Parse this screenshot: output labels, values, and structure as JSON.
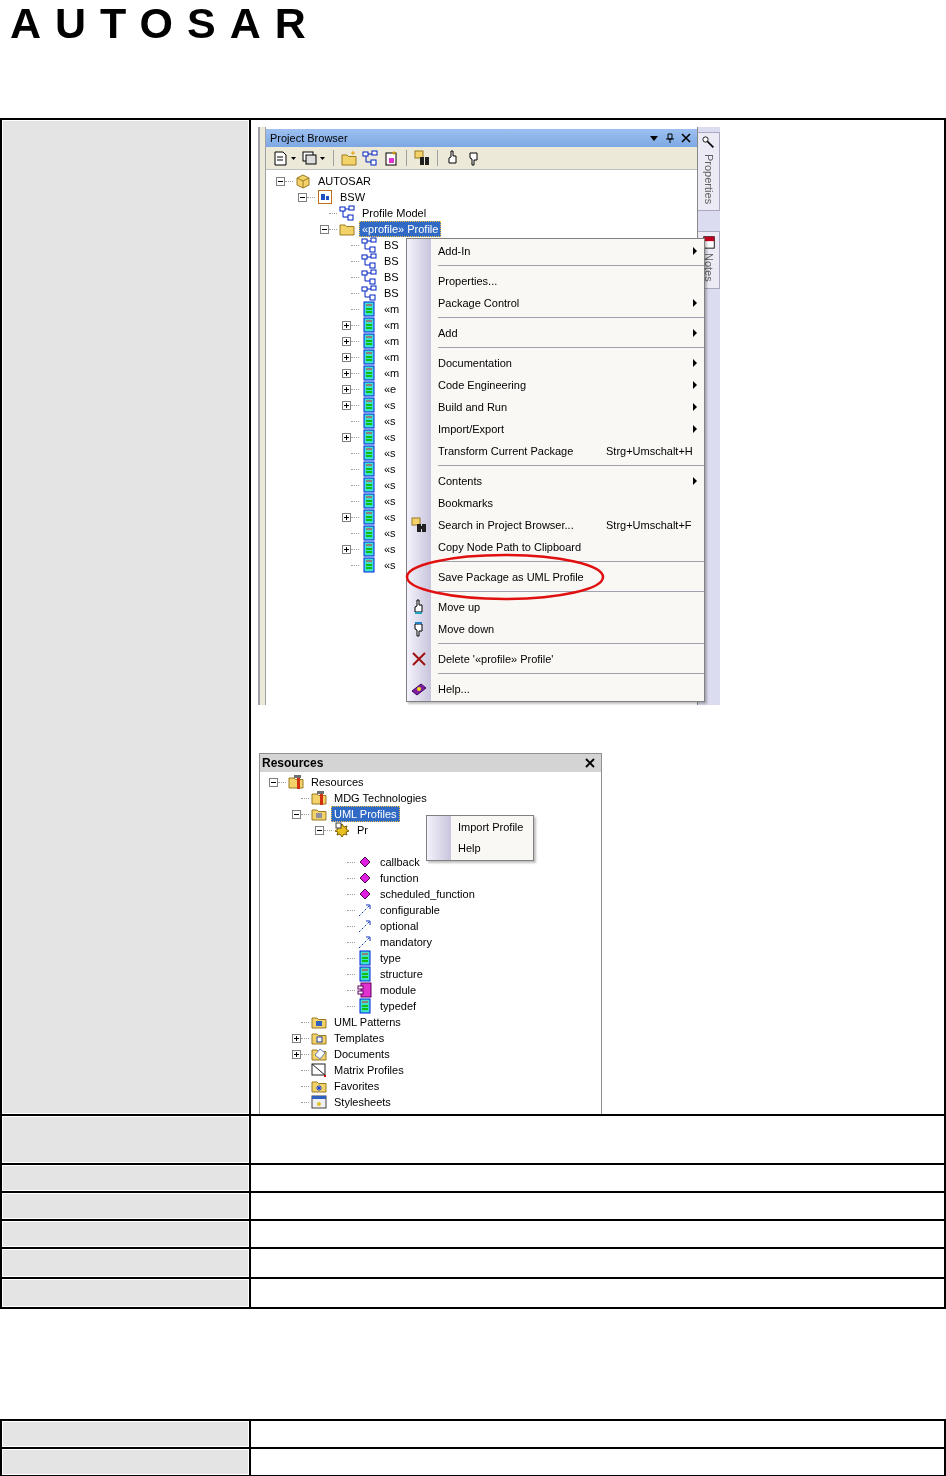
{
  "logo": "AUTOSAR",
  "project_browser": {
    "title": "Project Browser",
    "side_tabs": [
      "Properties",
      "Notes"
    ],
    "tree": [
      {
        "label": "AUTOSAR",
        "kind": "root-package",
        "expanded": true,
        "selected": false,
        "children": [
          {
            "label": "BSW",
            "kind": "model-package",
            "expanded": true,
            "selected": false,
            "children": [
              {
                "label": "Profile Model",
                "kind": "diagram",
                "selected": false
              },
              {
                "label": "«profile» Profile",
                "kind": "folder",
                "expanded": true,
                "selected": true,
                "children": [
                  {
                    "label": "BS",
                    "kind": "diagram",
                    "selected": false
                  },
                  {
                    "label": "BS",
                    "kind": "diagram",
                    "selected": false
                  },
                  {
                    "label": "BS",
                    "kind": "diagram",
                    "selected": false
                  },
                  {
                    "label": "BS",
                    "kind": "diagram",
                    "selected": false
                  },
                  {
                    "label": "«m",
                    "kind": "class",
                    "selected": false
                  },
                  {
                    "label": "«m",
                    "kind": "class",
                    "expanded": false,
                    "selected": false
                  },
                  {
                    "label": "«m",
                    "kind": "class",
                    "expanded": false,
                    "selected": false
                  },
                  {
                    "label": "«m",
                    "kind": "class",
                    "expanded": false,
                    "selected": false
                  },
                  {
                    "label": "«m",
                    "kind": "class",
                    "expanded": false,
                    "selected": false
                  },
                  {
                    "label": "«e",
                    "kind": "class",
                    "expanded": false,
                    "selected": false
                  },
                  {
                    "label": "«s",
                    "kind": "class",
                    "expanded": false,
                    "selected": false
                  },
                  {
                    "label": "«s",
                    "kind": "class",
                    "selected": false
                  },
                  {
                    "label": "«s",
                    "kind": "class",
                    "expanded": false,
                    "selected": false
                  },
                  {
                    "label": "«s",
                    "kind": "class",
                    "selected": false
                  },
                  {
                    "label": "«s",
                    "kind": "class",
                    "selected": false
                  },
                  {
                    "label": "«s",
                    "kind": "class",
                    "selected": false
                  },
                  {
                    "label": "«s",
                    "kind": "class",
                    "selected": false
                  },
                  {
                    "label": "«s",
                    "kind": "class",
                    "expanded": false,
                    "selected": false
                  },
                  {
                    "label": "«s",
                    "kind": "class",
                    "selected": false
                  },
                  {
                    "label": "«s",
                    "kind": "class",
                    "expanded": false,
                    "selected": false
                  },
                  {
                    "label": "«s",
                    "kind": "class",
                    "selected": false
                  }
                ]
              }
            ]
          }
        ]
      }
    ],
    "context_menu": [
      {
        "kind": "item",
        "label": "Add-In",
        "submenu": true
      },
      {
        "kind": "separator"
      },
      {
        "kind": "item",
        "label": "Properties...",
        "submenu": false
      },
      {
        "kind": "item",
        "label": "Package Control",
        "submenu": true
      },
      {
        "kind": "separator"
      },
      {
        "kind": "item",
        "label": "Add",
        "submenu": true
      },
      {
        "kind": "separator"
      },
      {
        "kind": "item",
        "label": "Documentation",
        "submenu": true
      },
      {
        "kind": "item",
        "label": "Code Engineering",
        "submenu": true
      },
      {
        "kind": "item",
        "label": "Build and Run",
        "submenu": true
      },
      {
        "kind": "item",
        "label": "Import/Export",
        "submenu": true
      },
      {
        "kind": "item",
        "label": "Transform Current Package",
        "shortcut": "Strg+Umschalt+H",
        "submenu": false
      },
      {
        "kind": "separator"
      },
      {
        "kind": "item",
        "label": "Contents",
        "submenu": true
      },
      {
        "kind": "item",
        "label": "Bookmarks",
        "submenu": false
      },
      {
        "kind": "search-item",
        "label": "Search in Project Browser...",
        "shortcut": "Strg+Umschalt+F",
        "submenu": false
      },
      {
        "kind": "item",
        "label": "Copy Node Path to Clipboard",
        "submenu": false
      },
      {
        "kind": "separator"
      },
      {
        "kind": "item",
        "label": "Save Package as UML Profile",
        "submenu": false,
        "circled": true
      },
      {
        "kind": "separator"
      },
      {
        "kind": "up-item",
        "label": "Move up",
        "submenu": false
      },
      {
        "kind": "down-item",
        "label": "Move down",
        "submenu": false
      },
      {
        "kind": "separator"
      },
      {
        "kind": "delete-item",
        "label": "Delete '«profile» Profile'",
        "submenu": false
      },
      {
        "kind": "separator"
      },
      {
        "kind": "help-item",
        "label": "Help...",
        "submenu": false
      }
    ]
  },
  "resources": {
    "title": "Resources",
    "tree": [
      {
        "label": "Resources",
        "kind": "tools-folder",
        "expanded": true,
        "selected": false,
        "children": [
          {
            "label": "MDG Technologies",
            "kind": "tools-folder",
            "selected": false
          },
          {
            "label": "UML Profiles",
            "kind": "profile-folder",
            "expanded": true,
            "selected": true,
            "children": [
              {
                "label": "Pr",
                "kind": "gear",
                "expanded": true,
                "selected": false,
                "children": [
                  {
                    "label": "callback",
                    "kind": "stereotype",
                    "selected": false
                  },
                  {
                    "label": "function",
                    "kind": "stereotype",
                    "selected": false
                  },
                  {
                    "label": "scheduled_function",
                    "kind": "stereotype",
                    "selected": false
                  },
                  {
                    "label": "configurable",
                    "kind": "connector",
                    "selected": false
                  },
                  {
                    "label": "optional",
                    "kind": "connector",
                    "selected": false
                  },
                  {
                    "label": "mandatory",
                    "kind": "connector",
                    "selected": false
                  },
                  {
                    "label": "type",
                    "kind": "class",
                    "selected": false
                  },
                  {
                    "label": "structure",
                    "kind": "class",
                    "selected": false
                  },
                  {
                    "label": "module",
                    "kind": "component",
                    "selected": false
                  },
                  {
                    "label": "typedef",
                    "kind": "class",
                    "selected": false
                  }
                ]
              }
            ]
          },
          {
            "label": "UML Patterns",
            "kind": "pattern-folder",
            "selected": false
          },
          {
            "label": "Templates",
            "kind": "template-folder",
            "expanded": false,
            "selected": false
          },
          {
            "label": "Documents",
            "kind": "doc-folder",
            "expanded": false,
            "selected": false
          },
          {
            "label": "Matrix Profiles",
            "kind": "matrix",
            "selected": false
          },
          {
            "label": "Favorites",
            "kind": "fav-folder",
            "selected": false
          },
          {
            "label": "Stylesheets",
            "kind": "stylesheet",
            "selected": false
          }
        ]
      }
    ],
    "popup_menu": [
      "Import Profile",
      "Help"
    ]
  }
}
